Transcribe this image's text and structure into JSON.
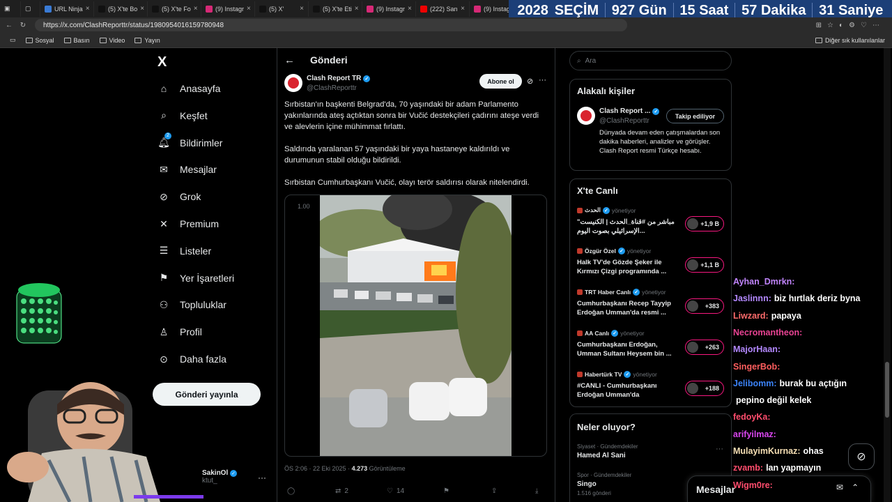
{
  "browser": {
    "tabs": [
      {
        "label": "URL Ninja",
        "color": "#3a7bd5"
      },
      {
        "label": "(5) X'te Bo",
        "color": "#111"
      },
      {
        "label": "(5) X'te Fo",
        "color": "#111"
      },
      {
        "label": "(9) Instagr",
        "color": "#d62976"
      },
      {
        "label": "(5) X'",
        "color": "#111"
      },
      {
        "label": "(5) X'te Eti",
        "color": "#111"
      },
      {
        "label": "(9) Instagr",
        "color": "#d62976"
      },
      {
        "label": "(222) San",
        "color": "#e00"
      },
      {
        "label": "(9) Instagr",
        "color": "#d62976"
      }
    ],
    "url": "https://x.com/ClashReporttr/status/1980954016159780948",
    "bookmarks": [
      "Sosyal",
      "Basın",
      "Video",
      "Yayın"
    ],
    "other_bookmarks": "Diğer sık kullanılanlar"
  },
  "countdown": {
    "year": "2028",
    "label": "SEÇİM",
    "days": "927 Gün",
    "hours": "15 Saat",
    "minutes": "57 Dakika",
    "seconds": "31 Saniye"
  },
  "sidebar": {
    "logo": "X",
    "items": [
      {
        "label": "Anasayfa",
        "icon": "home-icon"
      },
      {
        "label": "Keşfet",
        "icon": "search-icon"
      },
      {
        "label": "Bildirimler",
        "icon": "bell-icon",
        "badge": "2"
      },
      {
        "label": "Mesajlar",
        "icon": "mail-icon"
      },
      {
        "label": "Grok",
        "icon": "grok-icon"
      },
      {
        "label": "Premium",
        "icon": "x-premium-icon"
      },
      {
        "label": "Listeler",
        "icon": "list-icon"
      },
      {
        "label": "Yer İşaretleri",
        "icon": "bookmark-icon"
      },
      {
        "label": "Topluluklar",
        "icon": "communities-icon"
      },
      {
        "label": "Profil",
        "icon": "profile-icon"
      },
      {
        "label": "Daha fazla",
        "icon": "more-icon"
      }
    ],
    "post_button": "Gönderi yayınla",
    "account_name": "SakinOl",
    "account_handle": "ktut_"
  },
  "post": {
    "header_title": "Gönderi",
    "author_name": "Clash Report TR",
    "author_handle": "@ClashReporttr",
    "subscribe_label": "Abone ol",
    "paragraphs": [
      "Sırbistan'ın başkenti Belgrad'da, 70 yaşındaki bir adam Parlamento yakınlarında ateş açtıktan sonra bir Vučić destekçileri çadırını ateşe verdi ve alevlerin içine mühimmat fırlattı.",
      "Saldırıda yaralanan 57 yaşındaki bir yaya hastaneye kaldırıldı ve durumunun stabil olduğu bildirildi.",
      "Sırbistan Cumhurbaşkanı Vučić, olayı terör saldırısı olarak nitelendirdi."
    ],
    "video_time": "1.00",
    "time": "ÖS 2:06 · 22 Eki 2025 · ",
    "views_count": "4.273",
    "views_label": " Görüntüleme",
    "actions": {
      "reply": "",
      "repost": "2",
      "like": "14"
    }
  },
  "right": {
    "search_placeholder": "Ara",
    "related_title": "Alakalı kişiler",
    "related": {
      "name": "Clash Report ...",
      "handle": "@ClashReporttr",
      "follow_label": "Takip ediliyor",
      "bio": "Dünyada devam eden çatışmalardan son dakika haberleri, analizler ve görüşler. Clash Report resmi Türkçe hesabı."
    },
    "live_title": "X'te Canlı",
    "live": [
      {
        "source": "الحدث",
        "status": "yönetiyor",
        "text": "مباشر من #قناة_الحدث | الكنيست\" الإسرائيلي بصوت اليوم...",
        "count": "+1,9 B"
      },
      {
        "source": "Özgür Özel",
        "status": "yönetiyor",
        "text": "Halk TV'de Gözde Şeker ile Kırmızı Çizgi programında ...",
        "count": "+1,1 B"
      },
      {
        "source": "TRT Haber Canlı",
        "status": "yönetiyor",
        "text": "Cumhurbaşkanı Recep Tayyip Erdoğan Umman'da resmi ...",
        "count": "+383"
      },
      {
        "source": "AA Canlı",
        "status": "yönetiyor",
        "text": "Cumhurbaşkanı Erdoğan, Umman Sultanı Heysem bin ...",
        "count": "+263"
      },
      {
        "source": "Habertürk TV",
        "status": "yönetiyor",
        "text": "#CANLI - Cumhurbaşkanı Erdoğan Umman'da",
        "count": "+188"
      }
    ],
    "trends_title": "Neler oluyor?",
    "trends": [
      {
        "category": "Siyaset · Gündemdekiler",
        "name": "Hamed Al Sani",
        "posts": ""
      },
      {
        "category": "Spor · Gündemdekiler",
        "name": "Singo",
        "posts": "1.516 gönderi"
      }
    ],
    "messages_label": "Mesajlar"
  },
  "chat": [
    {
      "user": "Ayhan_Dmrkn:",
      "msg": "",
      "color": "#c084fc"
    },
    {
      "user": "Jaslinnn:",
      "msg": "biz hırtlak deriz byna",
      "color": "#b388ff"
    },
    {
      "user": "Liwzard:",
      "msg": "papaya",
      "color": "#ff6b6b"
    },
    {
      "user": "Necromantheon:",
      "msg": "",
      "color": "#e84393"
    },
    {
      "user": "MajorHaan:",
      "msg": "",
      "color": "#b388ff"
    },
    {
      "user": "SingerBob:",
      "msg": "",
      "color": "#ff5e5e"
    },
    {
      "user": "Jelibomm:",
      "msg": "burak bu açtığın",
      "color": "#3b82f6"
    },
    {
      "user": "",
      "msg": "pepino değil kelek",
      "color": "#fff"
    },
    {
      "user": "fedoyKa:",
      "msg": "",
      "color": "#ff4d6d"
    },
    {
      "user": "arifyilmaz:",
      "msg": "",
      "color": "#d946ef"
    },
    {
      "user": "MulayimKurnaz:",
      "msg": "ohas",
      "color": "#f5deb3"
    },
    {
      "user": "zvamb:",
      "msg": "lan yapmayın",
      "color": "#ff4d6d"
    },
    {
      "user": "Wigm0re:",
      "msg": "",
      "color": "#ff4d6d"
    }
  ]
}
